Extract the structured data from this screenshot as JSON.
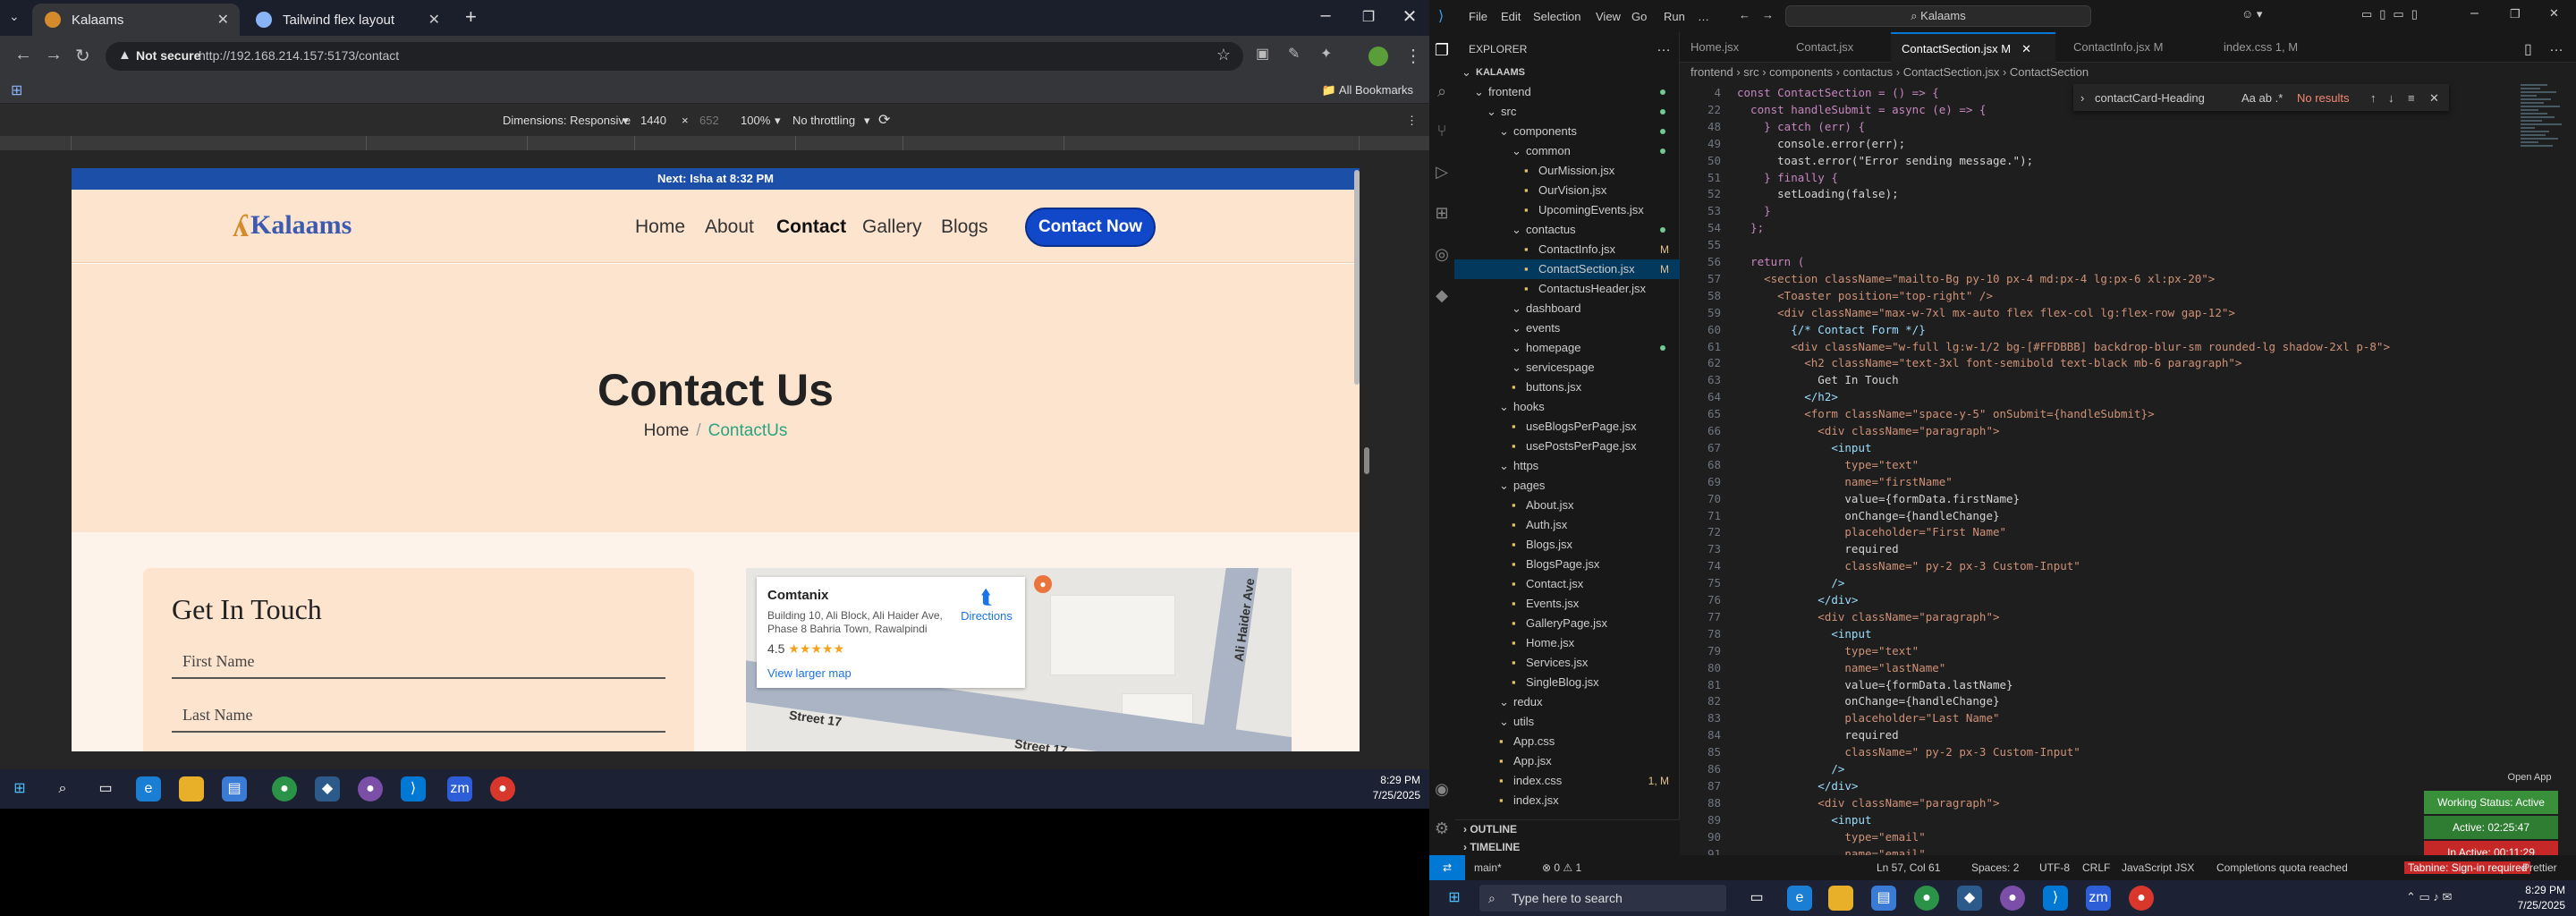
{
  "browser": {
    "tabs": [
      {
        "title": "Kalaams",
        "active": true
      },
      {
        "title": "Tailwind flex layout",
        "active": false
      }
    ],
    "not_secure": "Not secure",
    "url": "http://192.168.214.157:5173/contact",
    "all_bookmarks": "All Bookmarks",
    "devtools": {
      "dimensions_label": "Dimensions: Responsive",
      "width": "1440",
      "times": "×",
      "height": "652",
      "zoom": "100%",
      "throttle": "No throttling"
    }
  },
  "site": {
    "announcement": "Next: Isha at 8:32 PM",
    "logo_text": "Kalaams",
    "nav": [
      "Home",
      "About",
      "Contact",
      "Gallery",
      "Blogs"
    ],
    "nav_active": "Contact",
    "cta": "Contact Now",
    "hero_title": "Contact Us",
    "crumb_home": "Home",
    "crumb_sep": "/",
    "crumb_current": "ContactUs",
    "form_title": "Get In Touch",
    "fields": [
      "First Name",
      "Last Name"
    ],
    "map": {
      "name": "Comtanix",
      "address": "Building 10, Ali Block, Ali Haider Ave, Phase 8 Bahria Town, Rawalpindi",
      "rating": "4.5",
      "stars": "★★★★★",
      "view_larger": "View larger map",
      "directions": "Directions",
      "street1": "Street 17",
      "street2": "Street 17",
      "avenue": "Ali Haider Ave"
    }
  },
  "taskbar_left": {
    "time": "8:29 PM",
    "date": "7/25/2025"
  },
  "vscode": {
    "menus": [
      "File",
      "Edit",
      "Selection",
      "View",
      "Go",
      "Run",
      "…"
    ],
    "search": "Kalaams",
    "explorer_title": "EXPLORER",
    "tree": [
      {
        "label": "KALAAMS",
        "indent": 0,
        "kind": "root"
      },
      {
        "label": "frontend",
        "indent": 1,
        "kind": "folder",
        "dot": true
      },
      {
        "label": "src",
        "indent": 2,
        "kind": "folder",
        "dot": true
      },
      {
        "label": "components",
        "indent": 3,
        "kind": "folder",
        "dot": true
      },
      {
        "label": "common",
        "indent": 4,
        "kind": "folder",
        "dot": true
      },
      {
        "label": "OurMission.jsx",
        "indent": 5,
        "kind": "file"
      },
      {
        "label": "OurVision.jsx",
        "indent": 5,
        "kind": "file"
      },
      {
        "label": "UpcomingEvents.jsx",
        "indent": 5,
        "kind": "file"
      },
      {
        "label": "contactus",
        "indent": 4,
        "kind": "folder",
        "dot": true
      },
      {
        "label": "ContactInfo.jsx",
        "indent": 5,
        "kind": "file",
        "mod": "M"
      },
      {
        "label": "ContactSection.jsx",
        "indent": 5,
        "kind": "file",
        "mod": "M",
        "selected": true
      },
      {
        "label": "ContactusHeader.jsx",
        "indent": 5,
        "kind": "file"
      },
      {
        "label": "dashboard",
        "indent": 4,
        "kind": "folder"
      },
      {
        "label": "events",
        "indent": 4,
        "kind": "folder"
      },
      {
        "label": "homepage",
        "indent": 4,
        "kind": "folder",
        "dot": true
      },
      {
        "label": "servicespage",
        "indent": 4,
        "kind": "folder"
      },
      {
        "label": "buttons.jsx",
        "indent": 4,
        "kind": "file"
      },
      {
        "label": "hooks",
        "indent": 3,
        "kind": "folder"
      },
      {
        "label": "useBlogsPerPage.jsx",
        "indent": 4,
        "kind": "file"
      },
      {
        "label": "usePostsPerPage.jsx",
        "indent": 4,
        "kind": "file"
      },
      {
        "label": "https",
        "indent": 3,
        "kind": "folder"
      },
      {
        "label": "pages",
        "indent": 3,
        "kind": "folder"
      },
      {
        "label": "About.jsx",
        "indent": 4,
        "kind": "file"
      },
      {
        "label": "Auth.jsx",
        "indent": 4,
        "kind": "file"
      },
      {
        "label": "Blogs.jsx",
        "indent": 4,
        "kind": "file"
      },
      {
        "label": "BlogsPage.jsx",
        "indent": 4,
        "kind": "file"
      },
      {
        "label": "Contact.jsx",
        "indent": 4,
        "kind": "file"
      },
      {
        "label": "Events.jsx",
        "indent": 4,
        "kind": "file"
      },
      {
        "label": "GalleryPage.jsx",
        "indent": 4,
        "kind": "file"
      },
      {
        "label": "Home.jsx",
        "indent": 4,
        "kind": "file"
      },
      {
        "label": "Services.jsx",
        "indent": 4,
        "kind": "file"
      },
      {
        "label": "SingleBlog.jsx",
        "indent": 4,
        "kind": "file"
      },
      {
        "label": "redux",
        "indent": 3,
        "kind": "folder"
      },
      {
        "label": "utils",
        "indent": 3,
        "kind": "folder"
      },
      {
        "label": "App.css",
        "indent": 3,
        "kind": "file"
      },
      {
        "label": "App.jsx",
        "indent": 3,
        "kind": "file"
      },
      {
        "label": "index.css",
        "indent": 3,
        "kind": "file",
        "mod": "1, M"
      },
      {
        "label": "index.jsx",
        "indent": 3,
        "kind": "file"
      }
    ],
    "tabs": [
      {
        "title": "Home.jsx",
        "active": false
      },
      {
        "title": "Contact.jsx",
        "active": false
      },
      {
        "title": "ContactSection.jsx  M",
        "active": true
      },
      {
        "title": "ContactInfo.jsx  M",
        "active": false
      },
      {
        "title": "index.css  1, M",
        "active": false
      }
    ],
    "breadcrumb": "frontend › src › components › contactus › ContactSection.jsx › ContactSection",
    "find": {
      "query": "contactCard-Heading",
      "result": "No results"
    },
    "code": [
      {
        "n": "4",
        "t": "const ContactSection = () => {"
      },
      {
        "n": "22",
        "t": "  const handleSubmit = async (e) => {"
      },
      {
        "n": "48",
        "t": "    } catch (err) {"
      },
      {
        "n": "49",
        "t": "      console.error(err);"
      },
      {
        "n": "50",
        "t": "      toast.error(\"Error sending message.\");"
      },
      {
        "n": "51",
        "t": "    } finally {"
      },
      {
        "n": "52",
        "t": "      setLoading(false);"
      },
      {
        "n": "53",
        "t": "    }"
      },
      {
        "n": "54",
        "t": "  };"
      },
      {
        "n": "55",
        "t": ""
      },
      {
        "n": "56",
        "t": "  return ("
      },
      {
        "n": "57",
        "t": "    <section className=\"mailto-Bg py-10 px-4 md:px-4 lg:px-6 xl:px-20\">"
      },
      {
        "n": "58",
        "t": "      <Toaster position=\"top-right\" />"
      },
      {
        "n": "59",
        "t": "      <div className=\"max-w-7xl mx-auto flex flex-col lg:flex-row gap-12\">"
      },
      {
        "n": "60",
        "t": "        {/* Contact Form */}"
      },
      {
        "n": "61",
        "t": "        <div className=\"w-full lg:w-1/2 bg-[#FFDBBB] backdrop-blur-sm rounded-lg shadow-2xl p-8\">"
      },
      {
        "n": "62",
        "t": "          <h2 className=\"text-3xl font-semibold text-black mb-6 paragraph\">"
      },
      {
        "n": "63",
        "t": "            Get In Touch"
      },
      {
        "n": "64",
        "t": "          </h2>"
      },
      {
        "n": "65",
        "t": "          <form className=\"space-y-5\" onSubmit={handleSubmit}>"
      },
      {
        "n": "66",
        "t": "            <div className=\"paragraph\">"
      },
      {
        "n": "67",
        "t": "              <input"
      },
      {
        "n": "68",
        "t": "                type=\"text\""
      },
      {
        "n": "69",
        "t": "                name=\"firstName\""
      },
      {
        "n": "70",
        "t": "                value={formData.firstName}"
      },
      {
        "n": "71",
        "t": "                onChange={handleChange}"
      },
      {
        "n": "72",
        "t": "                placeholder=\"First Name\""
      },
      {
        "n": "73",
        "t": "                required"
      },
      {
        "n": "74",
        "t": "                className=\" py-2 px-3 Custom-Input\""
      },
      {
        "n": "75",
        "t": "              />"
      },
      {
        "n": "76",
        "t": "            </div>"
      },
      {
        "n": "77",
        "t": "            <div className=\"paragraph\">"
      },
      {
        "n": "78",
        "t": "              <input"
      },
      {
        "n": "79",
        "t": "                type=\"text\""
      },
      {
        "n": "80",
        "t": "                name=\"lastName\""
      },
      {
        "n": "81",
        "t": "                value={formData.lastName}"
      },
      {
        "n": "82",
        "t": "                onChange={handleChange}"
      },
      {
        "n": "83",
        "t": "                placeholder=\"Last Name\""
      },
      {
        "n": "84",
        "t": "                required"
      },
      {
        "n": "85",
        "t": "                className=\" py-2 px-3 Custom-Input\""
      },
      {
        "n": "86",
        "t": "              />"
      },
      {
        "n": "87",
        "t": "            </div>"
      },
      {
        "n": "88",
        "t": "            <div className=\"paragraph\">"
      },
      {
        "n": "89",
        "t": "              <input"
      },
      {
        "n": "90",
        "t": "                type=\"email\""
      },
      {
        "n": "91",
        "t": "                name=\"email\""
      }
    ],
    "outline": "OUTLINE",
    "timeline": "TIMELINE",
    "status": {
      "branch": "main*",
      "problems": "⊗ 0  ⚠ 1",
      "cursor": "Ln 57, Col 61",
      "spaces": "Spaces: 2",
      "encoding": "UTF-8",
      "eol": "CRLF",
      "lang": "JavaScript JSX",
      "completions": "Completions quota reached",
      "tabnine": "Tabnine: Sign-in required",
      "prettier": "Prettier"
    },
    "open_app": "Open App",
    "working_status": "Working Status: Active",
    "active_time": "Active: 02:25:47",
    "inactive_time": "In Active: 00:11:29"
  },
  "taskbar_right": {
    "search": "Type here to search",
    "time": "8:29 PM",
    "date": "7/25/2025"
  }
}
